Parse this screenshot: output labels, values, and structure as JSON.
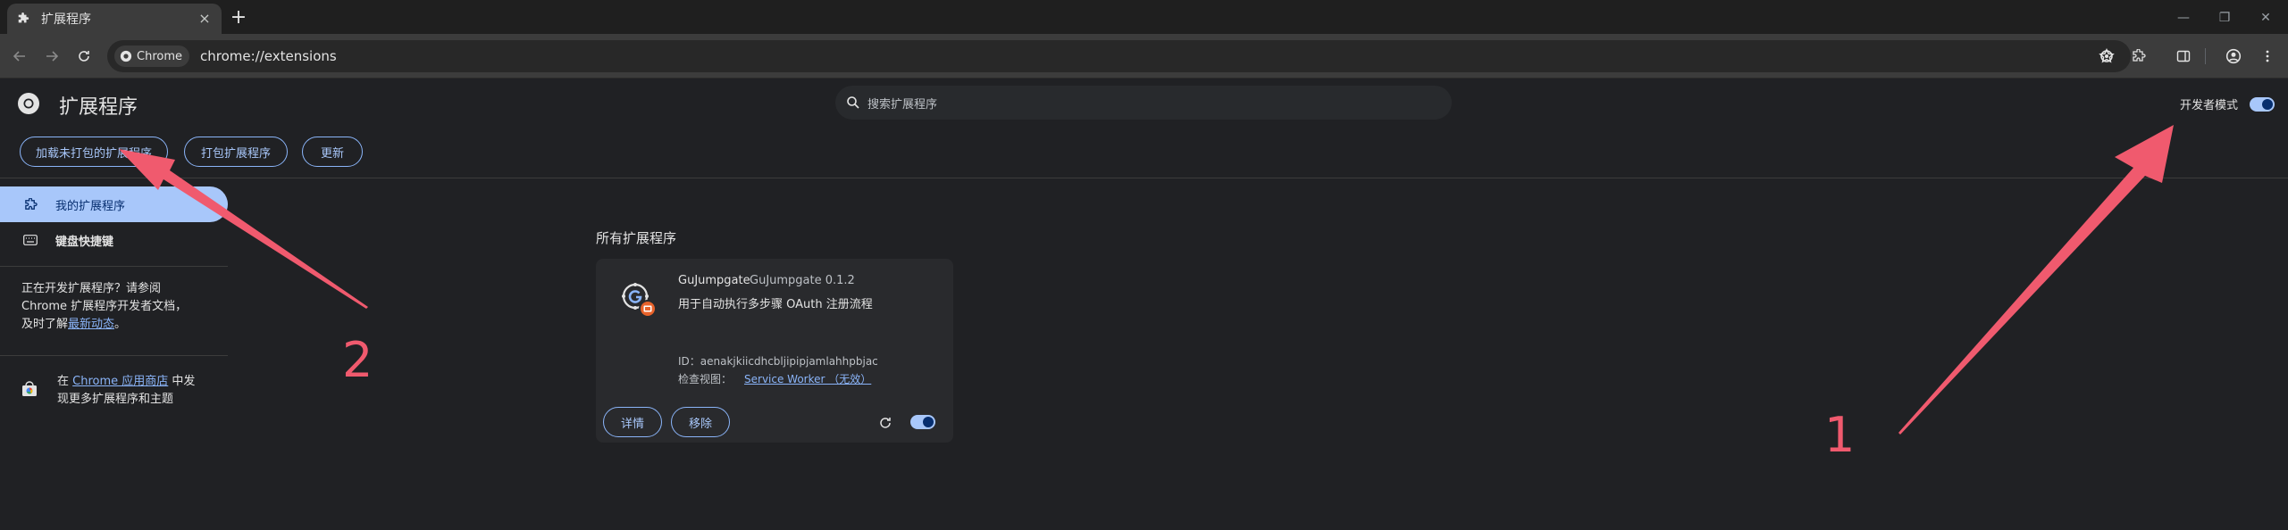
{
  "tab": {
    "title": "扩展程序",
    "close": "×",
    "new_tab": "+"
  },
  "window_controls": {
    "minimize": "—",
    "restore": "❐",
    "close": "✕"
  },
  "toolbar": {
    "chip_label": "Chrome",
    "url": "chrome://extensions"
  },
  "header": {
    "title": "扩展程序",
    "search_placeholder": "搜索扩展程序",
    "dev_mode_label": "开发者模式",
    "dev_mode_on": true
  },
  "dev_toolbar": {
    "load_unpacked": "加载未打包的扩展程序",
    "pack": "打包扩展程序",
    "update": "更新"
  },
  "sidebar": {
    "my_extensions": "我的扩展程序",
    "keyboard_shortcuts": "键盘快捷键",
    "dev_line1": "正在开发扩展程序？请参阅",
    "dev_line2": "Chrome 扩展程序开发者文档，",
    "dev_line3_prefix": "及时了解",
    "dev_link": "最新动态",
    "dev_line3_suffix": "。",
    "store_prefix": "在",
    "store_link": "Chrome 应用商店",
    "store_mid": "中发",
    "store_line2": "现更多扩展程序和主题"
  },
  "main": {
    "section_title": "所有扩展程序",
    "extension": {
      "name": "GuJumpgate",
      "version": "GuJumpgate 0.1.2",
      "description": "用于自动执行多步骤 OAuth 注册流程",
      "id_label": "ID：",
      "id": "aenakjkiicdhcbljipipjamlahhpbjac",
      "inspect_label": "检查视图：",
      "inspect_link": "Service Worker （无效）",
      "details": "详情",
      "remove": "移除",
      "enabled": true
    }
  },
  "annotations": {
    "arrow1_label": "1",
    "arrow2_label": "2",
    "color": "#f05a6e"
  },
  "colors": {
    "accent": "#a8c7fa",
    "link": "#8ab4f8",
    "background": "#202124",
    "card": "#292a2d",
    "badge": "#e8632b"
  }
}
